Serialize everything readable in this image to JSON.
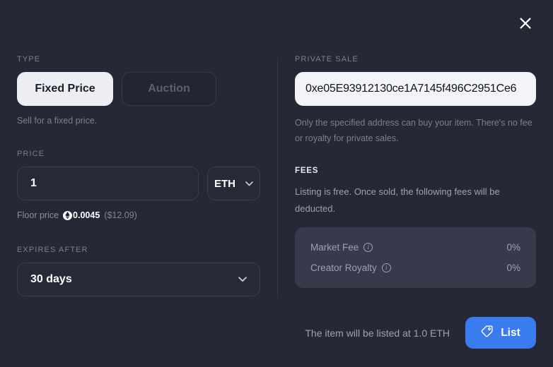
{
  "modal": {
    "close_label": "close-icon"
  },
  "type_section": {
    "label": "TYPE",
    "options": [
      {
        "label": "Fixed Price",
        "selected": true
      },
      {
        "label": "Auction",
        "selected": false
      }
    ],
    "helper": "Sell for a fixed price."
  },
  "price_section": {
    "label": "PRICE",
    "value": "1",
    "placeholder": "Amount",
    "currency": "ETH",
    "floor_label": "Floor price",
    "floor_amount": "0.0045",
    "floor_usd": "($12.09)"
  },
  "expires_section": {
    "label": "EXPIRES AFTER",
    "value": "30 days"
  },
  "private_sale": {
    "label": "PRIVATE SALE",
    "address": "0xe05E93912130ce1A7145f496C2951Ce6",
    "placeholder": "Enter wallet address",
    "description": "Only the specified address can buy your item. There's no fee or royalty for private sales."
  },
  "fees": {
    "label": "FEES",
    "description": "Listing is free. Once sold, the following fees will be deducted.",
    "rows": [
      {
        "name": "Market Fee",
        "value": "0%"
      },
      {
        "name": "Creator Royalty",
        "value": "0%"
      }
    ]
  },
  "footer": {
    "note": "The item will be listed at 1.0 ETH",
    "button_label": "List",
    "button_icon": "price-tag-icon"
  },
  "colors": {
    "background": "#262836",
    "accent_blue": "#3b7bf0",
    "field_dark": "#272937",
    "field_light": "#f2f4f8",
    "fees_box": "#363a4a",
    "muted_text": "#7b7f92"
  }
}
